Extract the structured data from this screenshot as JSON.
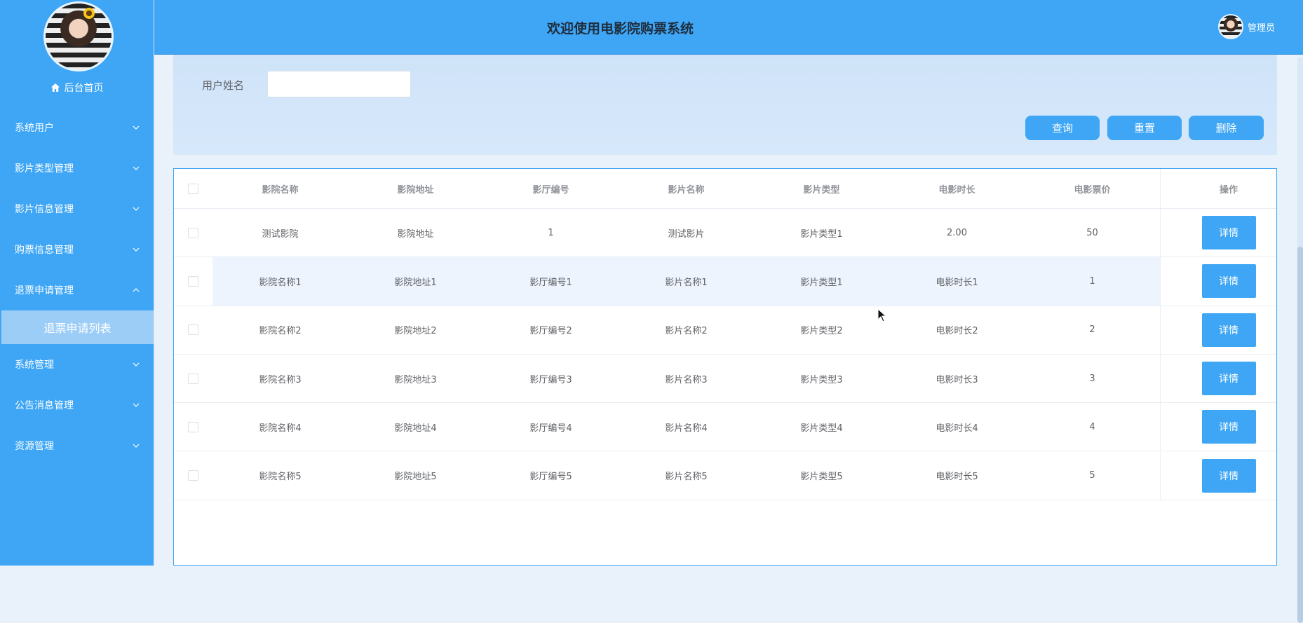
{
  "sidebar": {
    "home_label": "后台首页",
    "items": [
      {
        "label": "系统用户",
        "expanded": false
      },
      {
        "label": "影片类型管理",
        "expanded": false
      },
      {
        "label": "影片信息管理",
        "expanded": false
      },
      {
        "label": "购票信息管理",
        "expanded": false
      },
      {
        "label": "退票申请管理",
        "expanded": true,
        "sub": "退票申请列表"
      },
      {
        "label": "系统管理",
        "expanded": false
      },
      {
        "label": "公告消息管理",
        "expanded": false
      },
      {
        "label": "资源管理",
        "expanded": false
      }
    ]
  },
  "header": {
    "title": "欢迎使用电影院购票系统",
    "user": "管理员"
  },
  "search": {
    "label": "用户姓名",
    "value": "",
    "placeholder": ""
  },
  "buttons": {
    "query": "查询",
    "reset": "重置",
    "delete": "删除"
  },
  "table": {
    "columns": [
      "影院名称",
      "影院地址",
      "影厅编号",
      "影片名称",
      "影片类型",
      "电影时长",
      "电影票价",
      "操作"
    ],
    "action_label": "详情",
    "rows": [
      [
        "测试影院",
        "影院地址",
        "1",
        "测试影片",
        "影片类型1",
        "2.00",
        "50"
      ],
      [
        "影院名称1",
        "影院地址1",
        "影厅编号1",
        "影片名称1",
        "影片类型1",
        "电影时长1",
        "1"
      ],
      [
        "影院名称2",
        "影院地址2",
        "影厅编号2",
        "影片名称2",
        "影片类型2",
        "电影时长2",
        "2"
      ],
      [
        "影院名称3",
        "影院地址3",
        "影厅编号3",
        "影片名称3",
        "影片类型3",
        "电影时长3",
        "3"
      ],
      [
        "影院名称4",
        "影院地址4",
        "影厅编号4",
        "影片名称4",
        "影片类型4",
        "电影时长4",
        "4"
      ],
      [
        "影院名称5",
        "影院地址5",
        "影厅编号5",
        "影片名称5",
        "影片类型5",
        "电影时长5",
        "5"
      ]
    ]
  },
  "colors": {
    "primary": "#3ea6f5",
    "submenu": "#9ccdf6",
    "panel": "#d3e6fa"
  }
}
